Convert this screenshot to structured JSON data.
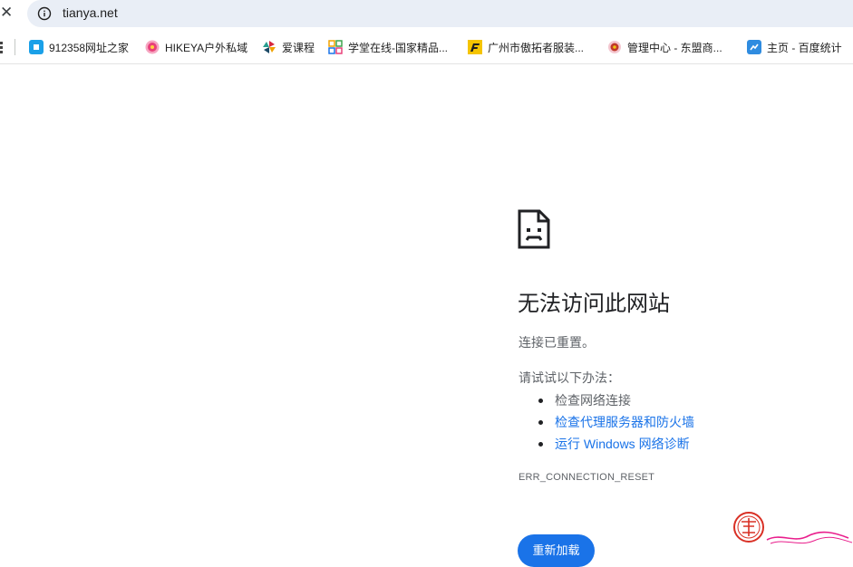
{
  "address_bar": {
    "url": "tianya.net",
    "info_icon": "info-icon",
    "close_icon": "close-icon"
  },
  "bookmarks": [
    {
      "label": "912358网址之家",
      "icon": "square-blue-favicon",
      "color": "#1aa0e8"
    },
    {
      "label": "HIKEYA户外私域",
      "icon": "flower-favicon",
      "color": "#e8407a"
    },
    {
      "label": "爱课程",
      "icon": "pinwheel-favicon",
      "color": "#d7263d"
    },
    {
      "label": "学堂在线-国家精品...",
      "icon": "grid-favicon",
      "color": "#f4a300"
    },
    {
      "label": "广州市傲拓者服装...",
      "icon": "f-logo-favicon",
      "color": "#f5c400"
    },
    {
      "label": "管理中心 - 东盟商...",
      "icon": "gear-flower-favicon",
      "color": "#c0392b"
    },
    {
      "label": "主页 - 百度统计",
      "icon": "chart-square-favicon",
      "color": "#2f8ce0"
    }
  ],
  "error": {
    "icon": "sad-document-icon",
    "title": "无法访问此网站",
    "subtitle": "连接已重置。",
    "try_label": "请试试以下办法：",
    "suggestions": [
      {
        "text": "检查网络连接",
        "link": false
      },
      {
        "text": "检查代理服务器和防火墙",
        "link": true
      },
      {
        "text": "运行 Windows 网络诊断",
        "link": true
      }
    ],
    "code": "ERR_CONNECTION_RESET",
    "reload_label": "重新加载"
  },
  "colors": {
    "accent": "#1a73e8",
    "omnibox_bg": "#e9eef6",
    "text_secondary": "#5f6368"
  }
}
